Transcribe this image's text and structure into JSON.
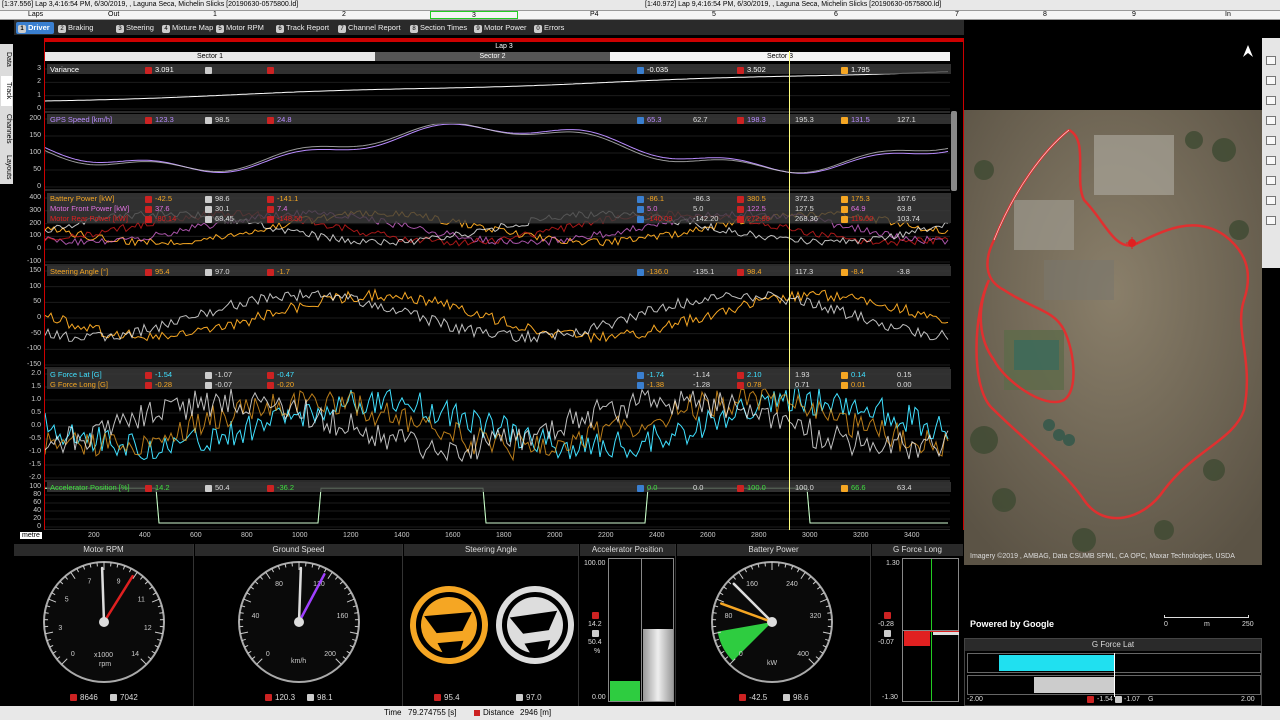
{
  "titlebar": {
    "left_title": "[1:37.556] Lap 3,4:16:54 PM, 6/30/2019, , Laguna Seca, Michelin Slicks [20190630-0575800.ld]",
    "right_title": "[1:40.972] Lap 9,4:16:54 PM, 6/30/2019, , Laguna Seca, Michelin Slicks [20190630-0575800.ld]"
  },
  "lap_ruler": {
    "label": "Laps",
    "markers": [
      "Out",
      "1",
      "2",
      "3",
      "P4",
      "5",
      "6",
      "7",
      "8",
      "9",
      "In"
    ]
  },
  "tabs": [
    {
      "num": "1",
      "label": "Driver",
      "selected": true
    },
    {
      "num": "2",
      "label": "Braking"
    },
    {
      "num": "3",
      "label": "Steering"
    },
    {
      "num": "4",
      "label": "Mixture Map"
    },
    {
      "num": "5",
      "label": "Motor RPM"
    },
    {
      "num": "6",
      "label": "Track Report"
    },
    {
      "num": "7",
      "label": "Channel Report"
    },
    {
      "num": "8",
      "label": "Section Times"
    },
    {
      "num": "9",
      "label": "Motor Power"
    },
    {
      "num": "0",
      "label": "Errors"
    }
  ],
  "left_tabs": [
    "Data",
    "Track",
    "Channels",
    "Layouts"
  ],
  "plot": {
    "lap_label": "Lap 3",
    "sectors": [
      "Sector 1",
      "Sector 2",
      "Sector 3"
    ],
    "x_unit": "metre",
    "x_ticks": [
      "200",
      "400",
      "600",
      "800",
      "1000",
      "1200",
      "1400",
      "1600",
      "1800",
      "2000",
      "2200",
      "2400",
      "2600",
      "2800",
      "3000",
      "3200",
      "3400"
    ]
  },
  "rows": [
    {
      "channels": [
        {
          "name": "Variance",
          "color": "#ffffff",
          "min": "3.091",
          "avg": "",
          "max": ""
        }
      ],
      "right": {
        "min": "-0.035",
        "mid": "",
        "max": "3.502",
        "cur": "",
        "agg": "1.795",
        "last": ""
      },
      "yticks": [
        "3",
        "2",
        "1",
        "0"
      ]
    },
    {
      "channels": [
        {
          "name": "GPS Speed [km/h]",
          "color": "#b98cff",
          "min": "123.3",
          "avg": "98.5",
          "max": "24.8"
        }
      ],
      "right": {
        "min": "65.3",
        "mid": "62.7",
        "max": "198.3",
        "cur": "195.3",
        "agg": "131.5",
        "last": "127.1"
      },
      "yticks": [
        "200",
        "150",
        "100",
        "50",
        "0"
      ]
    },
    {
      "channels": [
        {
          "name": "Battery Power [kW]",
          "color": "#f5a623",
          "min": "-42.5",
          "avg": "98.6",
          "max": "-141.1",
          "rmin": "-86.1",
          "rmid": "-86.3",
          "rmax": "380.5",
          "rcur": "372.3",
          "ragg": "175.3",
          "rlast": "167.6"
        },
        {
          "name": "Motor Front Power [kW]",
          "color": "#e070e0",
          "min": "37.6",
          "avg": "30.1",
          "max": "7.4",
          "rmin": "5.0",
          "rmid": "5.0",
          "rmax": "122.5",
          "rcur": "127.5",
          "ragg": "64.9",
          "rlast": "63.8"
        },
        {
          "name": "Motor Rear Power [kW]",
          "color": "#e02020",
          "min": "-80.14",
          "avg": "68.45",
          "max": "-148.50",
          "rmin": "-140.09",
          "rmid": "-142.20",
          "rmax": "272.90",
          "rcur": "268.36",
          "ragg": "110.50",
          "rlast": "103.74"
        }
      ],
      "yticks": [
        "400",
        "300",
        "200",
        "100",
        "0",
        "-100"
      ]
    },
    {
      "channels": [
        {
          "name": "Steering Angle [°]",
          "color": "#f5a623",
          "min": "95.4",
          "avg": "97.0",
          "max": "-1.7"
        }
      ],
      "right": {
        "min": "-136.0",
        "mid": "-135.1",
        "max": "98.4",
        "cur": "117.3",
        "agg": "-8.4",
        "last": "-3.8"
      },
      "yticks": [
        "150",
        "100",
        "50",
        "0",
        "-50",
        "-100",
        "-150"
      ]
    },
    {
      "channels": [
        {
          "name": "G Force Lat [G]",
          "color": "#40e0ff",
          "min": "-1.54",
          "avg": "-1.07",
          "max": "-0.47",
          "rmin": "-1.74",
          "rmid": "-1.14",
          "rmax": "2.10",
          "rcur": "1.93",
          "ragg": "0.14",
          "rlast": "0.15"
        },
        {
          "name": "G Force Long [G]",
          "color": "#f5a623",
          "min": "-0.28",
          "avg": "-0.07",
          "max": "-0.20",
          "rmin": "-1.38",
          "rmid": "-1.28",
          "rmax": "0.78",
          "rcur": "0.71",
          "ragg": "0.01",
          "rlast": "0.00"
        }
      ],
      "yticks": [
        "2.0",
        "1.5",
        "1.0",
        "0.5",
        "0.0",
        "-0.5",
        "-1.0",
        "-1.5",
        "-2.0"
      ]
    },
    {
      "channels": [
        {
          "name": "Accelerator Position [%]",
          "color": "#40e040",
          "min": "14.2",
          "avg": "50.4",
          "max": "-36.2"
        }
      ],
      "right": {
        "min": "0.0",
        "mid": "0.0",
        "max": "100.0",
        "cur": "100.0",
        "agg": "66.6",
        "last": "63.4"
      },
      "yticks": [
        "100",
        "80",
        "60",
        "40",
        "20",
        "0"
      ]
    }
  ],
  "gauges": {
    "motor_rpm": {
      "title": "Motor RPM",
      "unit": "x1000",
      "unit2": "rpm",
      "ticks": [
        "0",
        "3",
        "5",
        "7",
        "9",
        "11",
        "12",
        "14"
      ],
      "val1": "8646",
      "val2": "7042"
    },
    "ground_speed": {
      "title": "Ground Speed",
      "unit": "km/h",
      "ticks": [
        "0",
        "40",
        "80",
        "120",
        "160",
        "200"
      ],
      "val1": "120.3",
      "val2": "98.1"
    },
    "steering_angle": {
      "title": "Steering Angle",
      "val1": "95.4",
      "val2": "97.0"
    },
    "accelerator": {
      "title": "Accelerator Position",
      "top": "100.00",
      "bottom": "0.00",
      "v1": "14.2",
      "v2": "50.4",
      "unit": "%",
      "fill1": 0.142,
      "fill2": 0.504
    },
    "battery_power": {
      "title": "Battery Power",
      "unit": "kW",
      "ticks": [
        "0",
        "80",
        "160",
        "240",
        "320",
        "400"
      ],
      "val1": "-42.5",
      "val2": "98.6"
    },
    "g_long": {
      "title": "G Force Long",
      "top": "1.30",
      "bottom": "-1.30",
      "v1": "-0.28",
      "v2": "-0.07"
    },
    "g_lat": {
      "title": "G Force Lat",
      "left": "-2.00",
      "right": "2.00",
      "v1": "-1.54",
      "v2": "-1.07",
      "unit": "G"
    }
  },
  "map": {
    "attribution": "Imagery ©2019 , AMBAG, Data CSUMB SFML, CA OPC, Maxar Technologies, USDA",
    "powered": "Powered by Google",
    "scale_left": "0",
    "scale_mid": "m",
    "scale_right": "250"
  },
  "status": {
    "time_label": "Time",
    "time_value": "79.274755 [s]",
    "dist_label": "Distance",
    "dist_value": "2946 [m]"
  }
}
